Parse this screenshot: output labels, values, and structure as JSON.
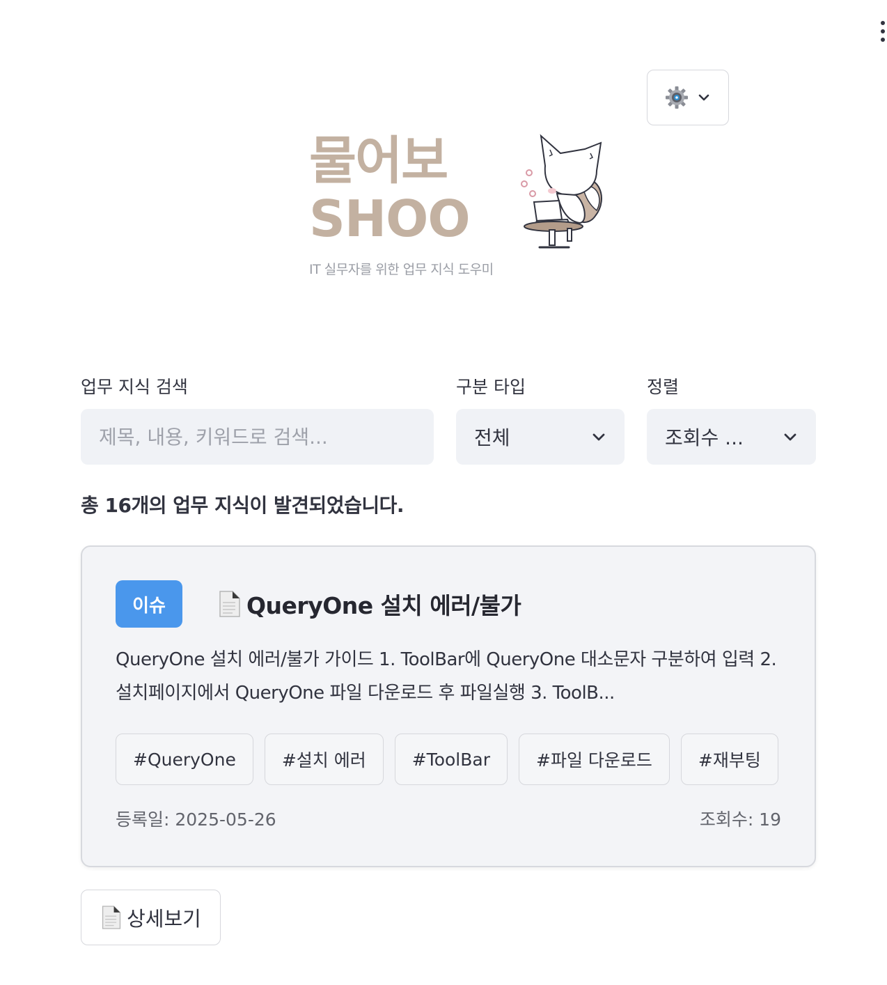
{
  "header": {
    "menu_icon": "kebab-menu-icon",
    "settings": {
      "icon": "gear-icon",
      "chevron": "chevron-down-icon"
    }
  },
  "logo": {
    "title_kr": "물어보",
    "title_en": "SHOO",
    "tagline": "IT 실무자를 위한 업무 지식 도우미",
    "mascot": "fox-with-laptop-illustration"
  },
  "filters": {
    "search": {
      "label": "업무 지식 검색",
      "placeholder": "제목, 내용, 키워드로 검색...",
      "value": ""
    },
    "type": {
      "label": "구분 타입",
      "value": "전체"
    },
    "sort": {
      "label": "정렬",
      "value": "조회수 ..."
    }
  },
  "results": {
    "summary": "총 16개의 업무 지식이 발견되었습니다."
  },
  "card": {
    "badge": "이슈",
    "badge_color": "#4a97ec",
    "title": "QueryOne 설치 에러/불가",
    "description": "QueryOne 설치 에러/불가 가이드 1. ToolBar에 QueryOne 대소문자 구분하여 입력 2. 설치페이지에서 QueryOne 파일 다운로드 후 파일실행 3. ToolB...",
    "tags": [
      "#QueryOne",
      "#설치 에러",
      "#ToolBar",
      "#파일 다운로드",
      "#재부팅"
    ],
    "date": "등록일: 2025-05-26",
    "views": "조회수: 19"
  },
  "detail_button": {
    "label": "상세보기",
    "icon": "document-icon"
  }
}
